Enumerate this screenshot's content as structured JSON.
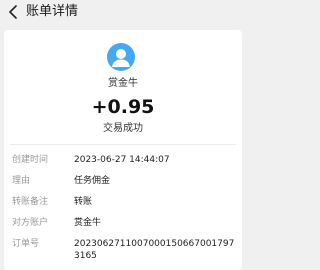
{
  "header": {
    "title": "账单详情",
    "back_icon": "chevron-left-icon"
  },
  "summary": {
    "avatar_icon": "user-avatar-icon",
    "avatar_color": "#45a8f5",
    "name": "赏金牛",
    "amount": "+0.95",
    "status": "交易成功"
  },
  "details": [
    {
      "label": "创建时间",
      "value": "2023-06-27 14:44:07"
    },
    {
      "label": "理由",
      "value": "任务佣金"
    },
    {
      "label": "转账备注",
      "value": "转账"
    },
    {
      "label": "对方账户",
      "value": "赏金牛"
    },
    {
      "label": "订单号",
      "value": "20230627110070001506670017973165"
    }
  ]
}
